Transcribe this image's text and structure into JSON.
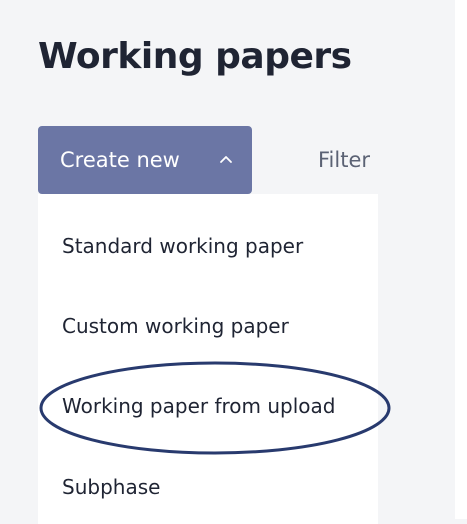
{
  "page": {
    "title": "Working papers"
  },
  "toolbar": {
    "create_label": "Create new",
    "filter_label": "Filter"
  },
  "menu": {
    "items": [
      {
        "label": "Standard working paper"
      },
      {
        "label": "Custom working paper"
      },
      {
        "label": "Working paper from upload"
      },
      {
        "label": "Subphase"
      }
    ]
  },
  "colors": {
    "accent": "#6b76a5",
    "highlight_oval": "#283a6e",
    "text": "#1f2433",
    "background": "#f4f5f7"
  }
}
